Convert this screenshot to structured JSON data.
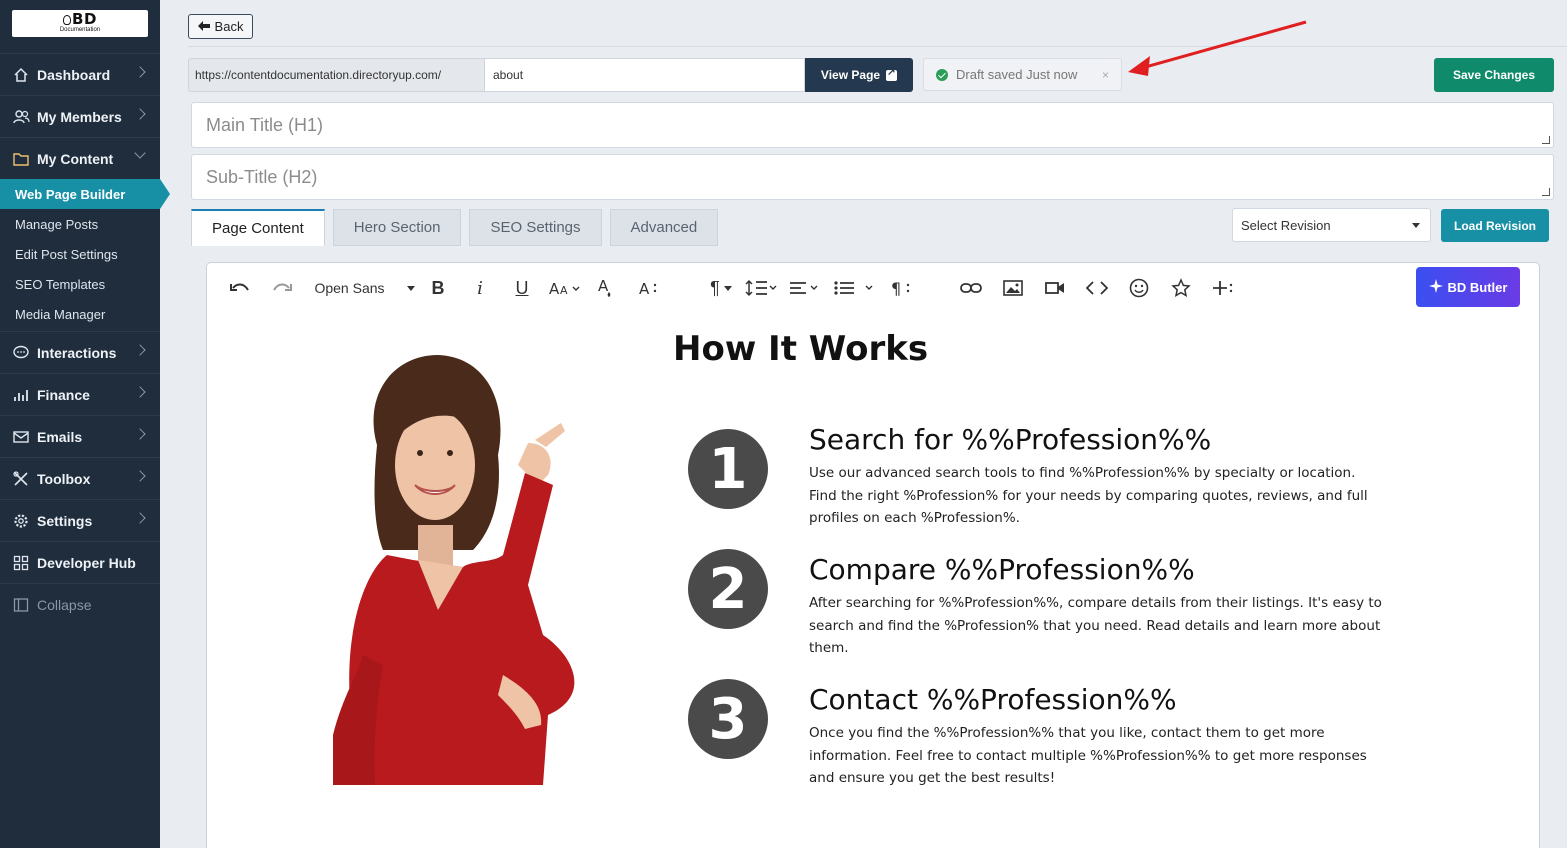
{
  "logo": {
    "text": "BD",
    "sub": "Documentation"
  },
  "sidebar": {
    "items": [
      {
        "label": "Dashboard",
        "icon": "home-icon"
      },
      {
        "label": "My Members",
        "icon": "users-icon"
      },
      {
        "label": "My Content",
        "icon": "folder-icon"
      }
    ],
    "sub_items": [
      {
        "label": "Web Page Builder",
        "active": true
      },
      {
        "label": "Manage Posts"
      },
      {
        "label": "Edit Post Settings"
      },
      {
        "label": "SEO Templates"
      },
      {
        "label": "Media Manager"
      }
    ],
    "items2": [
      {
        "label": "Interactions",
        "icon": "chat-icon"
      },
      {
        "label": "Finance",
        "icon": "bar-chart-icon"
      },
      {
        "label": "Emails",
        "icon": "envelope-icon"
      },
      {
        "label": "Toolbox",
        "icon": "tools-icon"
      },
      {
        "label": "Settings",
        "icon": "gear-icon"
      },
      {
        "label": "Developer Hub",
        "icon": "grid-icon"
      }
    ],
    "collapse_label": "Collapse"
  },
  "header": {
    "back_label": "Back",
    "url_prefix": "https://contentdocumentation.directoryup.com/",
    "url_value": "about",
    "view_page_label": "View Page",
    "draft_status": "Draft saved Just now",
    "draft_close": "×",
    "save_label": "Save Changes"
  },
  "form": {
    "main_title_placeholder": "Main Title (H1)",
    "sub_title_placeholder": "Sub-Title (H2)"
  },
  "tabs": [
    {
      "label": "Page Content",
      "active": true
    },
    {
      "label": "Hero Section"
    },
    {
      "label": "SEO Settings"
    },
    {
      "label": "Advanced"
    }
  ],
  "revision": {
    "select_label": "Select Revision",
    "load_label": "Load Revision"
  },
  "toolbar": {
    "font_name": "Open Sans",
    "butler_label": "BD Butler"
  },
  "content": {
    "title": "How It Works",
    "steps": [
      {
        "number": "1",
        "heading": "Search for %%Profession%%",
        "text": "Use our advanced search tools to find %%Profession%% by specialty or location. Find the right %Profession% for your needs by comparing quotes, reviews, and full profiles on each %Profession%."
      },
      {
        "number": "2",
        "heading": "Compare %%Profession%%",
        "text": "After searching for %%Profession%%, compare details from their listings. It's easy to search and find the %Profession% that you need. Read details and learn more about them."
      },
      {
        "number": "3",
        "heading": "Contact %%Profession%%",
        "text": "Once you find the %%Profession%% that you like, contact them to get more information. Feel free to contact multiple %%Profession%% to get more responses and ensure you get the best results!"
      }
    ]
  },
  "colors": {
    "sidebar_bg": "#1f2d3d",
    "active_nav": "#1790a6",
    "save_green": "#0f8a6b",
    "view_page_navy": "#24394f",
    "annotation_arrow": "#e02020"
  }
}
